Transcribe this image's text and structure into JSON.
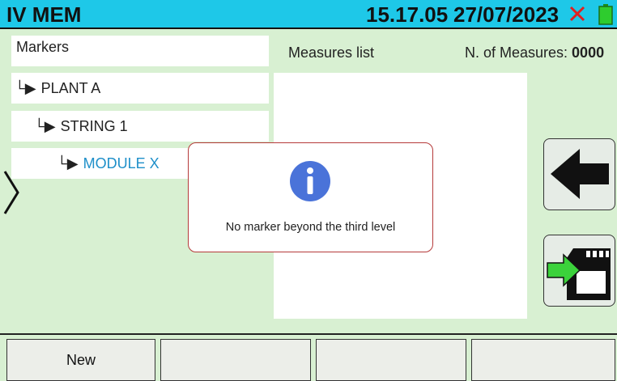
{
  "header": {
    "title": "IV MEM",
    "time": "15.17.05",
    "date": "27/07/2023",
    "status_icon": "red-x-icon",
    "battery_icon": "battery-icon"
  },
  "markers": {
    "label": "Markers",
    "items": [
      {
        "label": "PLANT A",
        "level": 1
      },
      {
        "label": "STRING 1",
        "level": 2
      },
      {
        "label": "MODULE X",
        "level": 3
      }
    ],
    "arrow_glyph": "└▶"
  },
  "measures": {
    "label": "Measures list",
    "count_label": "N. of Measures: ",
    "count_value": "0000"
  },
  "dialog": {
    "icon": "info-icon",
    "message": "No marker beyond the third level"
  },
  "side_buttons": {
    "back_icon": "back-arrow-icon",
    "save_icon": "save-to-sd-icon"
  },
  "softkeys": [
    "New",
    "",
    "",
    ""
  ],
  "colors": {
    "background": "#d8f0d2",
    "titlebar": "#1ec8e8",
    "highlight_text": "#1e8fc9",
    "dialog_border": "#b53a3a",
    "info_icon": "#4a73d9"
  }
}
